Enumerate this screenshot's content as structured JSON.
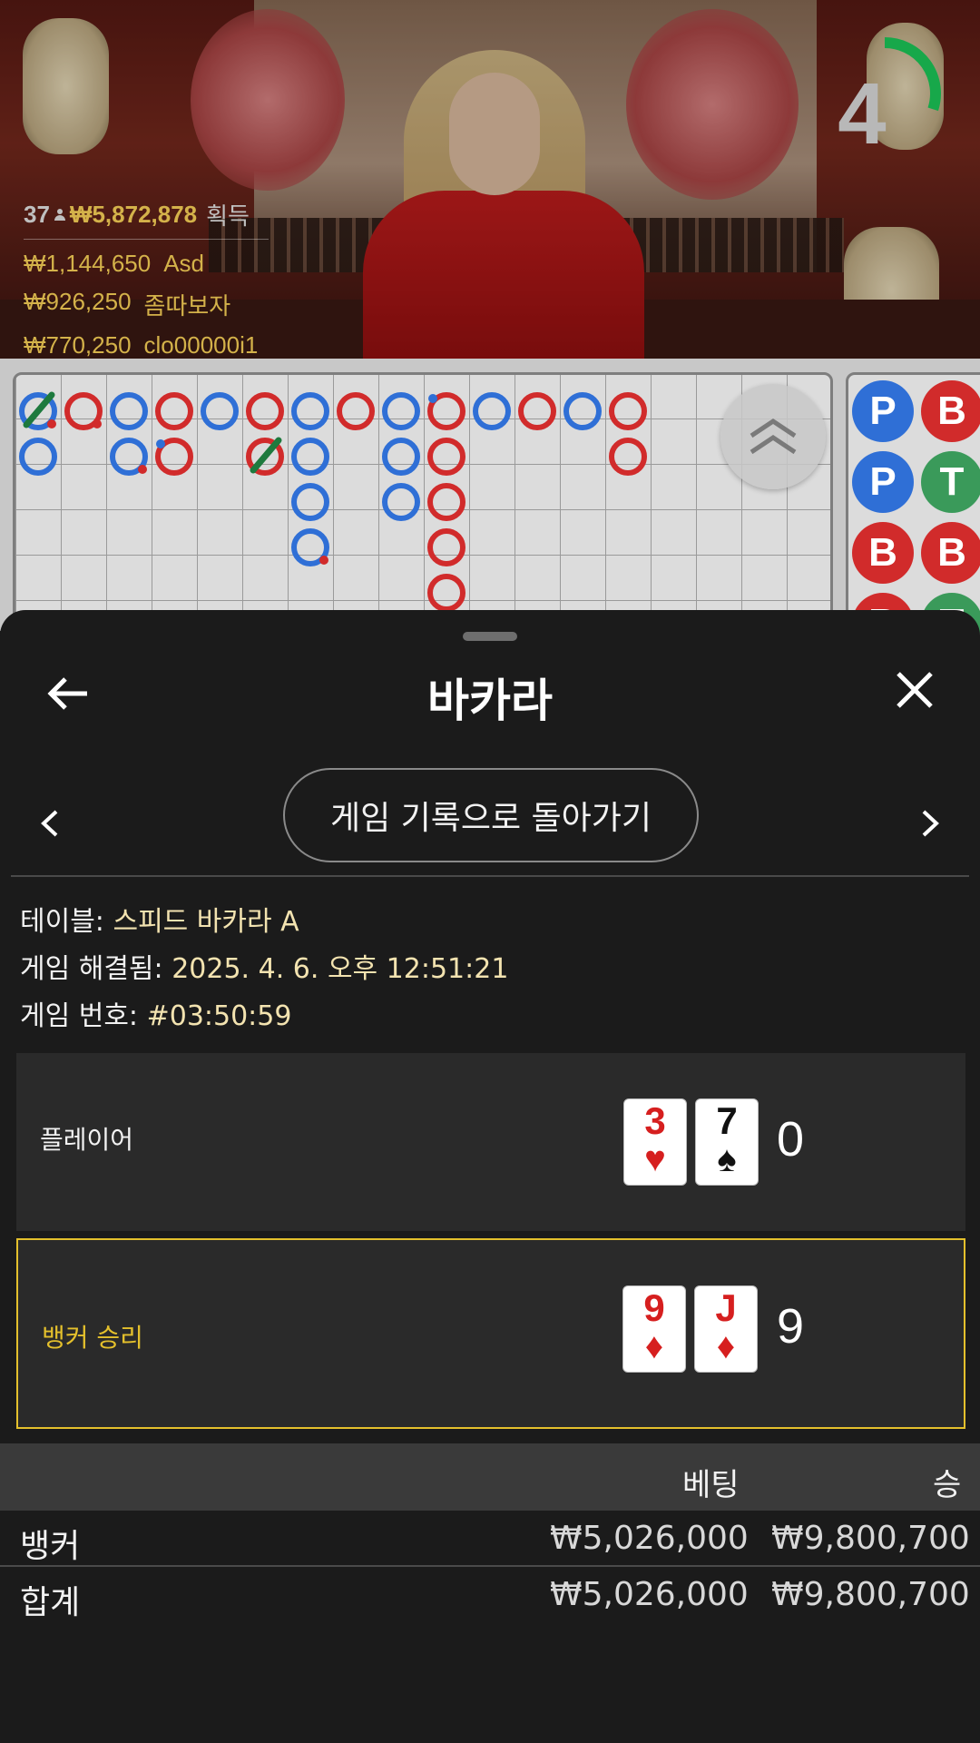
{
  "video": {
    "winners": {
      "count": "37",
      "total": "₩5,872,878",
      "earned_label": "획득",
      "list": [
        {
          "amount": "₩1,144,650",
          "name": "Asd"
        },
        {
          "amount": "₩926,250",
          "name": "좀따보자"
        },
        {
          "amount": "₩770,250",
          "name": "clo00000i1"
        }
      ]
    },
    "timer": {
      "value": "4",
      "remaining_fraction": 0.3,
      "color": "#17a84a"
    }
  },
  "scoreboard": {
    "colors": {
      "player": "#2f6fd6",
      "banker": "#d12b2b",
      "tie": "#3a9a5a"
    },
    "bead_plate": [
      "P",
      "B",
      "P",
      "T",
      "B",
      "B",
      "B",
      "T"
    ],
    "scroll_icon": "double-chevron-up-icon"
  },
  "sheet": {
    "title": "바카라",
    "back_icon": "arrow-left-icon",
    "close_icon": "close-icon",
    "return_button": "게임 기록으로 돌아가기",
    "info": {
      "table_label": "테이블:",
      "table_value": "스피드 바카라 A",
      "resolved_label": "게임 해결됨:",
      "resolved_value": "2025. 4. 6. 오후 12:51:21",
      "game_no_label": "게임 번호:",
      "game_no_value": "#03:50:59"
    },
    "player": {
      "label": "플레이어",
      "cards": [
        {
          "rank": "3",
          "suit": "♥",
          "color": "red"
        },
        {
          "rank": "7",
          "suit": "♠",
          "color": "black"
        }
      ],
      "score": "0"
    },
    "banker": {
      "label": "뱅커 승리",
      "cards": [
        {
          "rank": "9",
          "suit": "♦",
          "color": "red"
        },
        {
          "rank": "J",
          "suit": "♦",
          "color": "red"
        }
      ],
      "score": "9"
    },
    "bets": {
      "headers": {
        "bet": "베팅",
        "win": "승"
      },
      "rows": [
        {
          "name": "뱅커",
          "bet": "₩5,026,000",
          "win": "₩9,800,700"
        },
        {
          "name": "합계",
          "bet": "₩5,026,000",
          "win": "₩9,800,700"
        }
      ]
    }
  }
}
